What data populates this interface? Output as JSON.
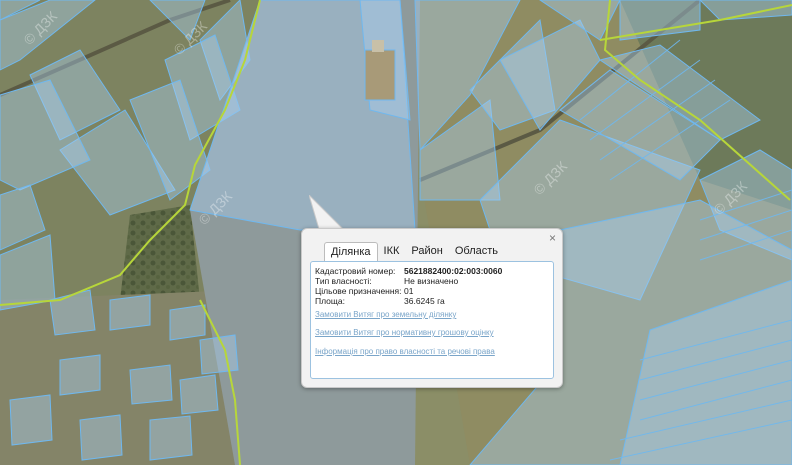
{
  "popup": {
    "close_glyph": "×",
    "tabs": [
      "Ділянка",
      "ІКК",
      "Район",
      "Область"
    ],
    "active_tab": "Ділянка",
    "rows": [
      {
        "key": "Кадастровий номер:",
        "value": "5621882400:02:003:0060"
      },
      {
        "key": "Тип власності:",
        "value": "Не визначено"
      },
      {
        "key": "Цільове призначення:",
        "value": "01"
      },
      {
        "key": "Площа:",
        "value": "36.6245 га"
      }
    ],
    "links": [
      "Замовити Витяг про земельну ділянку",
      "Замовити Витяг про нормативну грошову оцінку",
      "Інформація про право власності та речові права"
    ]
  },
  "watermark": "© ДЗК",
  "colors": {
    "parcel_fill": "#a9d0f0",
    "parcel_stroke": "#6fb8ef",
    "boundary_line": "#b7d63a",
    "link": "#7aa5c9"
  }
}
